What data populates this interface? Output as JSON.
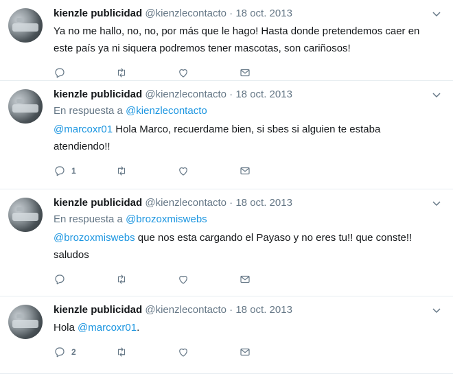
{
  "tweets": [
    {
      "name": "kienzle publicidad",
      "handle": "@kienzlecontacto",
      "sep": "·",
      "date": "18 oct. 2013",
      "text": "Ya no me hallo, no, no, por más que le hago! Hasta donde pretendemos caer en este país ya ni siquera podremos tener mascotas, son cariñosos!",
      "reply_count": ""
    },
    {
      "name": "kienzle publicidad",
      "handle": "@kienzlecontacto",
      "sep": "·",
      "date": "18 oct. 2013",
      "reply_to_prefix": "En respuesta a ",
      "reply_to_user": "@kienzlecontacto",
      "mention": "@marcoxr01",
      "text": " Hola Marco, recuerdame bien, si sbes si alguien te estaba atendiendo!!",
      "reply_count": "1"
    },
    {
      "name": "kienzle publicidad",
      "handle": "@kienzlecontacto",
      "sep": "·",
      "date": "18 oct. 2013",
      "reply_to_prefix": "En respuesta a ",
      "reply_to_user": "@brozoxmiswebs",
      "mention": "@brozoxmiswebs",
      "text": " que nos esta cargando el Payaso y no eres tu!! que conste!! saludos",
      "reply_count": ""
    },
    {
      "name": "kienzle publicidad",
      "handle": "@kienzlecontacto",
      "sep": "·",
      "date": "18 oct. 2013",
      "text_before": "Hola ",
      "mention": "@marcoxr01",
      "text_after": ".",
      "reply_count": "2"
    }
  ],
  "icons": {
    "reply": "reply-icon",
    "retweet": "retweet-icon",
    "like": "heart-icon",
    "dm": "envelope-icon",
    "caret": "chevron-down-icon"
  },
  "colors": {
    "text": "#14171a",
    "muted": "#657786",
    "link": "#1b95e0",
    "divider": "#e6ecf0"
  }
}
